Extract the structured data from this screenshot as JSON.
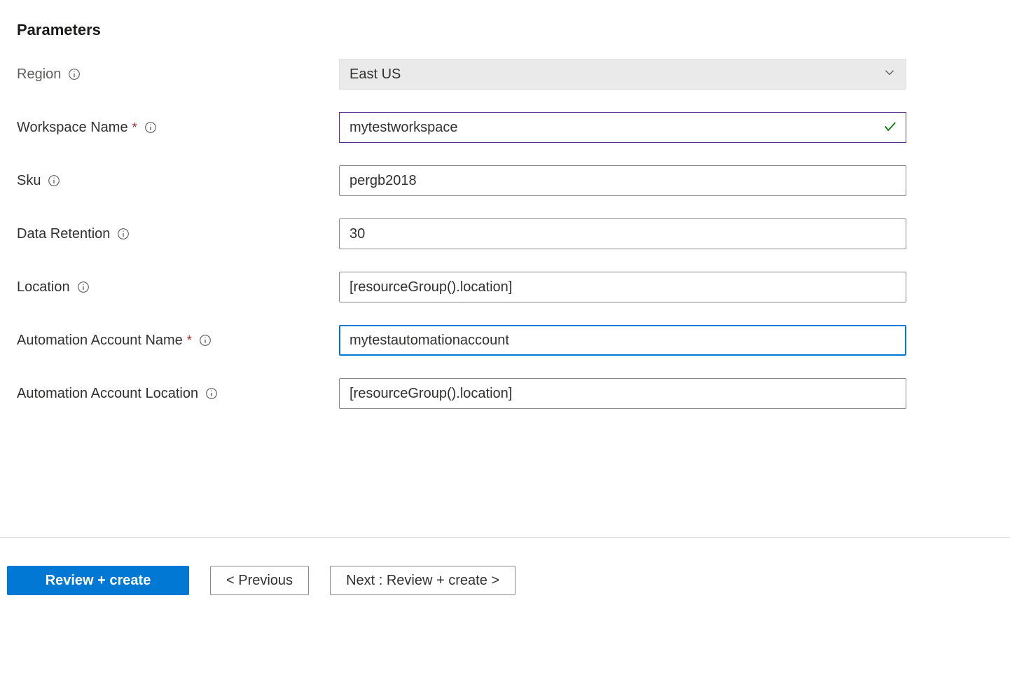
{
  "section": {
    "title": "Parameters"
  },
  "fields": {
    "region": {
      "label": "Region",
      "value": "East US"
    },
    "workspace_name": {
      "label": "Workspace Name",
      "value": "mytestworkspace"
    },
    "sku": {
      "label": "Sku",
      "value": "pergb2018"
    },
    "data_retention": {
      "label": "Data Retention",
      "value": "30"
    },
    "location": {
      "label": "Location",
      "value": "[resourceGroup().location]"
    },
    "automation_account_name": {
      "label": "Automation Account Name",
      "value": "mytestautomationaccount"
    },
    "automation_account_location": {
      "label": "Automation Account Location",
      "value": "[resourceGroup().location]"
    }
  },
  "footer": {
    "review": "Review + create",
    "previous": "< Previous",
    "next": "Next : Review + create >"
  }
}
